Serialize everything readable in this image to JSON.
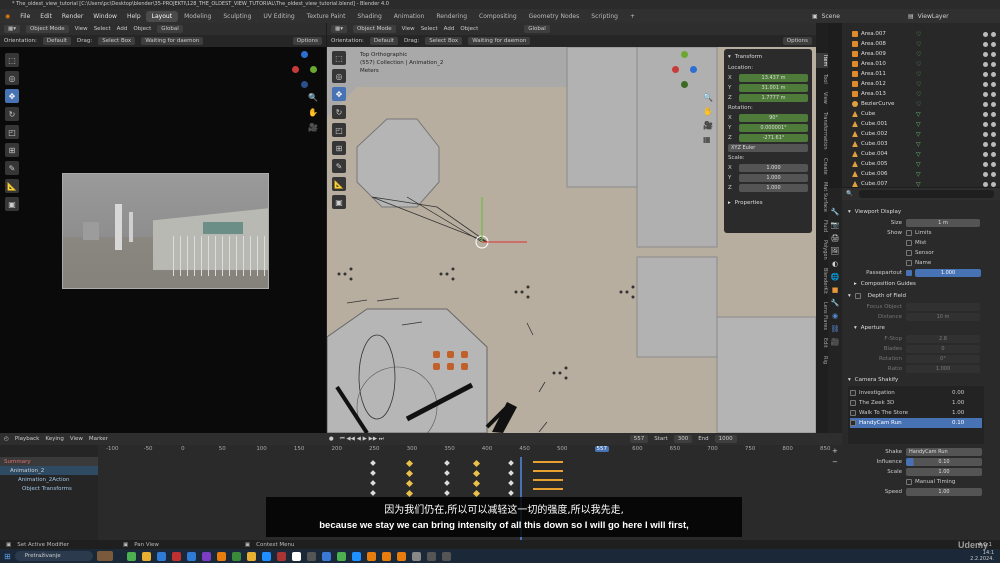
{
  "titlebar": {
    "title": "* The_oldest_view_tutorial [C:\\Users\\pc\\Desktop\\blender\\35-PROJEKTI\\128_THE_OLDEST_VIEW_TUTORIAL\\The_oldest_view_tutorial.blend] - Blender 4.0"
  },
  "menubar": {
    "menus": [
      "File",
      "Edit",
      "Render",
      "Window",
      "Help"
    ],
    "workspaces": [
      "Layout",
      "Modeling",
      "Sculpting",
      "UV Editing",
      "Texture Paint",
      "Shading",
      "Animation",
      "Rendering",
      "Compositing",
      "Geometry Nodes",
      "Scripting"
    ],
    "scene": "Scene",
    "view_layer": "ViewLayer"
  },
  "left_view": {
    "mode": "Object Mode",
    "menus": [
      "View",
      "Select",
      "Add",
      "Object"
    ],
    "orientation_label": "Orientation:",
    "orientation": "Default",
    "drag_label": "Drag:",
    "drag": "Select Box",
    "transform": "Global",
    "status": "Waiting for daemon",
    "options": "Options"
  },
  "main_view": {
    "mode": "Object Mode",
    "menus": [
      "View",
      "Select",
      "Add",
      "Object"
    ],
    "orientation_label": "Orientation:",
    "orientation": "Default",
    "drag_label": "Drag:",
    "drag": "Select Box",
    "transform": "Global",
    "status": "Waiting for daemon",
    "options": "Options",
    "overlay_title": "Top Orthographic",
    "overlay_collection": "(557) Collection | Animation_2",
    "overlay_units": "Meters"
  },
  "transform_panel": {
    "title": "Transform",
    "location_label": "Location:",
    "location": {
      "x": "13.437 m",
      "y": "31.001 m",
      "z": "1.7777 m"
    },
    "rotation_label": "Rotation:",
    "rotation": {
      "x": "90°",
      "y": "0.000001°",
      "z": "-271.61°"
    },
    "rotation_mode": "XYZ Euler",
    "scale_label": "Scale:",
    "scale": {
      "x": "1.000",
      "y": "1.000",
      "z": "1.000"
    },
    "properties_label": "Properties"
  },
  "side_tabs": [
    "Item",
    "Tool",
    "View",
    "Transformation",
    "Create",
    "Mat Surface",
    "Fluid",
    "Polygon",
    "BlenderKit",
    "Lens Flares",
    "Edit",
    "Rig"
  ],
  "outliner": {
    "items": [
      {
        "name": "Area.007",
        "type": "light"
      },
      {
        "name": "Area.008",
        "type": "light"
      },
      {
        "name": "Area.009",
        "type": "light"
      },
      {
        "name": "Area.010",
        "type": "light"
      },
      {
        "name": "Area.011",
        "type": "light"
      },
      {
        "name": "Area.012",
        "type": "light"
      },
      {
        "name": "Area.013",
        "type": "light"
      },
      {
        "name": "BezierCurve",
        "type": "curve"
      },
      {
        "name": "Cube",
        "type": "mesh"
      },
      {
        "name": "Cube.001",
        "type": "mesh"
      },
      {
        "name": "Cube.002",
        "type": "mesh"
      },
      {
        "name": "Cube.003",
        "type": "mesh"
      },
      {
        "name": "Cube.004",
        "type": "mesh"
      },
      {
        "name": "Cube.005",
        "type": "mesh"
      },
      {
        "name": "Cube.006",
        "type": "mesh"
      },
      {
        "name": "Cube.007",
        "type": "mesh"
      }
    ]
  },
  "properties": {
    "viewport_display": "Viewport Display",
    "size_label": "Size",
    "size": "1 m",
    "show_label": "Show",
    "show_opts": [
      "Limits",
      "Mist",
      "Sensor",
      "Name"
    ],
    "passepartout_label": "Passepartout",
    "passepartout": "1.000",
    "composition_guides": "Composition Guides",
    "depth_of_field": "Depth of Field",
    "focus_object_label": "Focus Object",
    "distance_label": "Distance",
    "distance": "10 m",
    "aperture": "Aperture",
    "fstop_label": "F-Stop",
    "fstop": "2.8",
    "blades_label": "Blades",
    "blades": "0",
    "rotation_label": "Rotation",
    "rotation": "0°",
    "ratio_label": "Ratio",
    "ratio": "1.000",
    "shakify": "Camera Shakify",
    "shakes": [
      {
        "name": "Investigation",
        "value": "0.00"
      },
      {
        "name": "The Zeek 3D",
        "value": "1.00"
      },
      {
        "name": "Walk To The Store",
        "value": "1.00"
      },
      {
        "name": "HandyCam Run",
        "value": "0.10"
      }
    ],
    "shake_label": "Shake",
    "shake": "HandyCam Run",
    "influence_label": "Influence",
    "influence": "0.10",
    "scale_label": "Scale",
    "scale": "1.00",
    "manual_timing": "Manual Timing",
    "speed_label": "Speed",
    "speed": "1.00"
  },
  "timeline": {
    "menus": [
      "Playback",
      "Keying",
      "View",
      "Marker"
    ],
    "current_frame": "557",
    "start_label": "Start",
    "start": "300",
    "end_label": "End",
    "end": "1000",
    "ticks": [
      "-100",
      "-50",
      "0",
      "50",
      "100",
      "150",
      "200",
      "250",
      "300",
      "350",
      "400",
      "450",
      "500",
      "557",
      "600",
      "650",
      "700",
      "750",
      "800",
      "850"
    ],
    "tree": [
      "Summary",
      "Animation_2",
      "Animation_2Action",
      "Object Transforms"
    ]
  },
  "subtitle": {
    "zh": "因为我们仍在,所以可以减轻这一切的强度,所以我先走,",
    "en": "because we stay we can bring intensity of all this down so I will go here I will first,"
  },
  "statusbar": {
    "left": "Set Active Modifier",
    "mid": "Pan View",
    "mid2": "Context Menu",
    "version": "4.0.1"
  },
  "taskbar": {
    "search": "Pretraživanje",
    "time": "14:1",
    "date": "2.2.2024.",
    "watermark": "Udemy"
  }
}
